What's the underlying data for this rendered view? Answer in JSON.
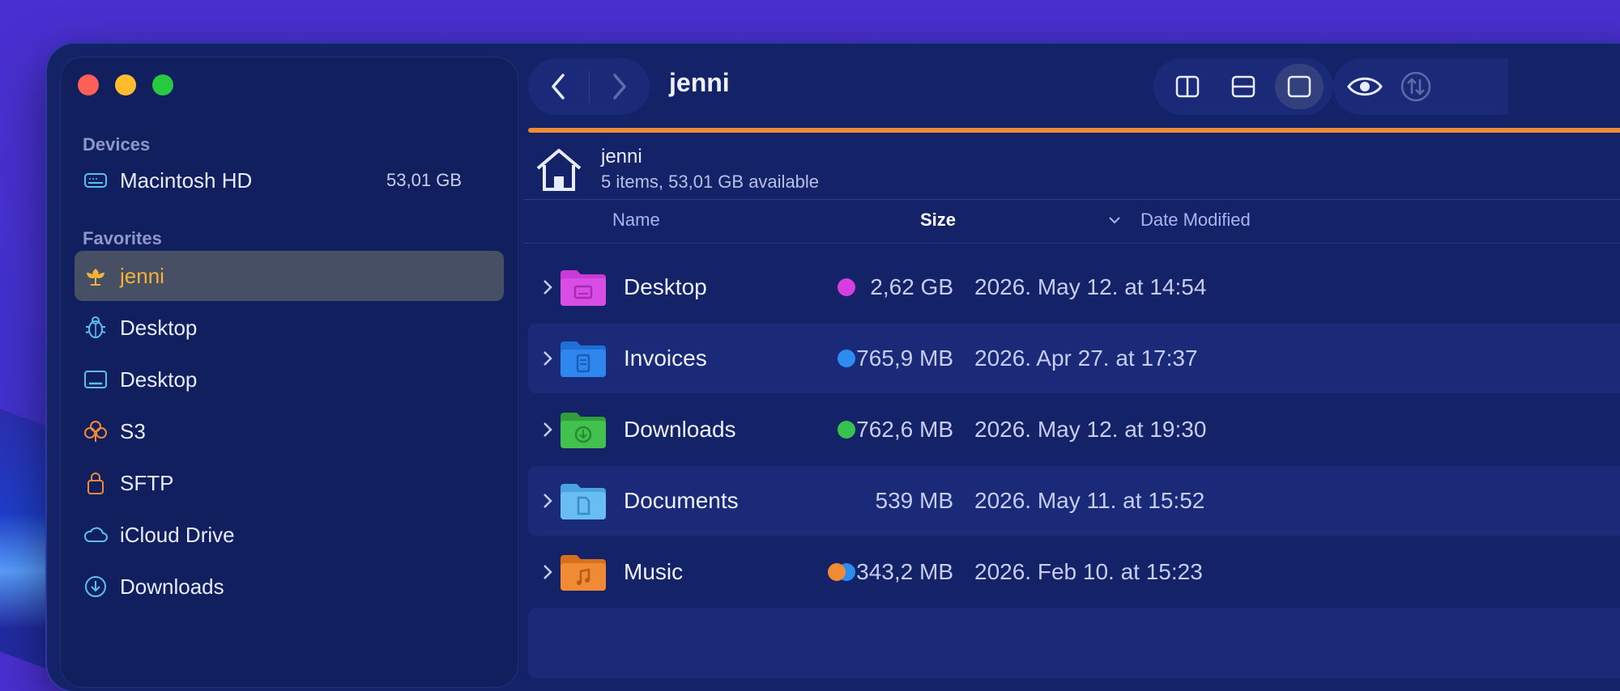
{
  "window": {
    "colors": {
      "accent_orange": "#f08a34",
      "selection": "#464f63",
      "selected_text": "#f5b23a"
    }
  },
  "sidebar": {
    "devices_header": "Devices",
    "devices": [
      {
        "label": "Macintosh HD",
        "capacity": "53,01 GB",
        "icon": "drive-icon"
      }
    ],
    "favorites_header": "Favorites",
    "favorites": [
      {
        "label": "jenni",
        "icon": "flower-icon",
        "selected": true
      },
      {
        "label": "Desktop",
        "icon": "bug-icon"
      },
      {
        "label": "Desktop",
        "icon": "display-icon"
      },
      {
        "label": "S3",
        "icon": "clover-icon"
      },
      {
        "label": "SFTP",
        "icon": "lock-icon"
      },
      {
        "label": "iCloud Drive",
        "icon": "cloud-icon"
      },
      {
        "label": "Downloads",
        "icon": "download-circle-icon"
      }
    ]
  },
  "toolbar": {
    "title": "jenni"
  },
  "location": {
    "name": "jenni",
    "info": "5 items, 53,01 GB available"
  },
  "columns": {
    "name": "Name",
    "size": "Size",
    "date": "Date Modified"
  },
  "files": [
    {
      "name": "Desktop",
      "size": "2,62 GB",
      "date": "2026. May 12. at 14:54",
      "tags": [
        "#d63ee0"
      ],
      "folder_color": "#c93bd6",
      "glyph": "desktop-glyph"
    },
    {
      "name": "Invoices",
      "size": "765,9 MB",
      "date": "2026. Apr 27. at 17:37",
      "tags": [
        "#2d8cf0"
      ],
      "folder_color": "#2a7fe6",
      "glyph": "doc-glyph"
    },
    {
      "name": "Downloads",
      "size": "762,6 MB",
      "date": "2026. May 12. at 19:30",
      "tags": [
        "#37c24f"
      ],
      "folder_color": "#3fbf4a",
      "glyph": "download-glyph"
    },
    {
      "name": "Documents",
      "size": "539 MB",
      "date": "2026. May 11. at 15:52",
      "tags": [],
      "folder_color": "#5fb6ee",
      "glyph": "page-glyph"
    },
    {
      "name": "Music",
      "size": "343,2 MB",
      "date": "2026. Feb 10. at 15:23",
      "tags": [
        "#f08a34",
        "#2d8cf0"
      ],
      "folder_color": "#f08a34",
      "glyph": "music-glyph"
    }
  ]
}
